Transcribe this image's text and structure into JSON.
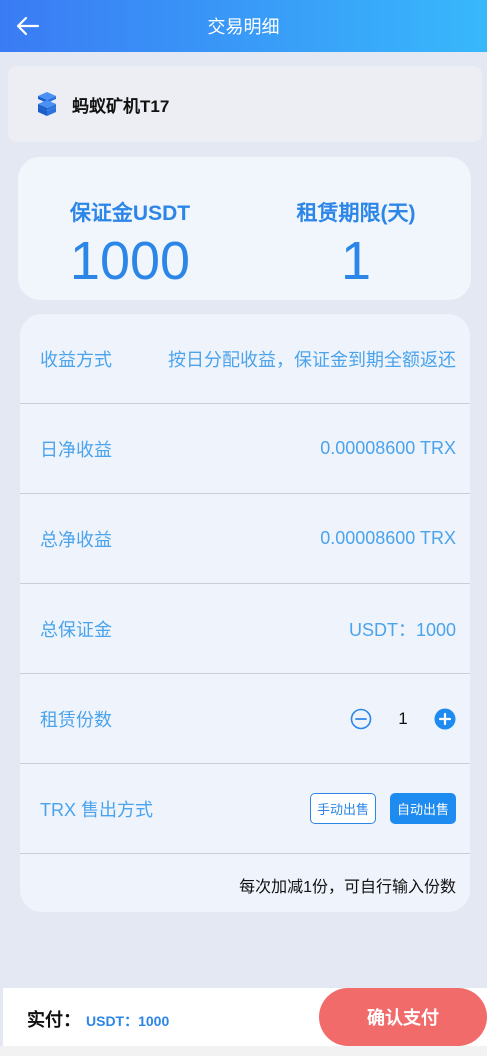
{
  "header": {
    "title": "交易明细",
    "back_icon": "arrow-left-icon"
  },
  "product": {
    "name": "蚂蚁矿机T17",
    "icon": "cube-stack-icon"
  },
  "stats": {
    "deposit_label": "保证金USDT",
    "deposit_value": "1000",
    "term_label": "租赁期限(天)",
    "term_value": "1"
  },
  "details": {
    "income_method_label": "收益方式",
    "income_method_value": "按日分配收益，保证金到期全额返还",
    "daily_income_label": "日净收益",
    "daily_income_value": "0.00008600 TRX",
    "total_income_label": "总净收益",
    "total_income_value": "0.00008600 TRX",
    "total_deposit_label": "总保证金",
    "total_deposit_value": "USDT：1000",
    "shares_label": "租赁份数",
    "shares_value": "1",
    "sell_method_label": "TRX 售出方式",
    "manual_sell_label": "手动出售",
    "auto_sell_label": "自动出售",
    "note": "每次加减1份，可自行输入份数"
  },
  "footer": {
    "pay_label": "实付：",
    "pay_amount": "USDT：1000",
    "confirm_label": "确认支付"
  },
  "colors": {
    "accent": "#2b86e7",
    "header_gradient_start": "#3a7bf4",
    "header_gradient_end": "#38b8fb",
    "confirm": "#f26b6b"
  }
}
